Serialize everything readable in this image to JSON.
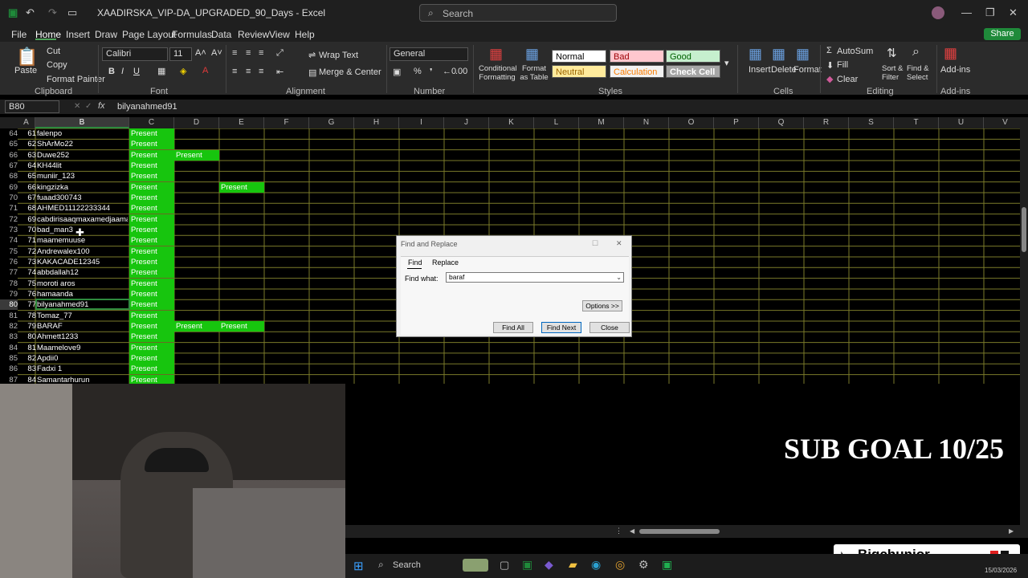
{
  "window": {
    "title": "XAADIRSKA_VIP-DA_UPGRADED_90_Days  -  Excel",
    "search_placeholder": "Search"
  },
  "menu": {
    "file": "File",
    "home": "Home",
    "insert": "Insert",
    "draw": "Draw",
    "page_layout": "Page Layout",
    "formulas": "Formulas",
    "data": "Data",
    "review": "Review",
    "view": "View",
    "help": "Help",
    "share": "Share"
  },
  "ribbon": {
    "clipboard": {
      "paste": "Paste",
      "cut": "Cut",
      "copy": "Copy",
      "format_painter": "Format Painter",
      "label": "Clipboard"
    },
    "font": {
      "name": "Calibri",
      "size": "11",
      "label": "Font"
    },
    "alignment": {
      "wrap_text": "Wrap Text",
      "merge_center": "Merge & Center",
      "label": "Alignment"
    },
    "number": {
      "format": "General",
      "label": "Number"
    },
    "styles": {
      "conditional": "Conditional Formatting",
      "format_table": "Format as Table",
      "normal": "Normal",
      "bad": "Bad",
      "good": "Good",
      "neutral": "Neutral",
      "calculation": "Calculation",
      "check_cell": "Check Cell",
      "label": "Styles"
    },
    "cells": {
      "insert": "Insert",
      "delete": "Delete",
      "format": "Format",
      "label": "Cells"
    },
    "editing": {
      "autosum": "AutoSum",
      "fill": "Fill",
      "clear": "Clear",
      "sort_filter": "Sort & Filter",
      "find_select": "Find & Select",
      "label": "Editing"
    },
    "addins": {
      "addins": "Add-ins",
      "label": "Add-ins"
    }
  },
  "formula_bar": {
    "name_box": "B80",
    "value": "bilyanahmed91"
  },
  "columns": [
    "A",
    "B",
    "C",
    "D",
    "E",
    "F",
    "G",
    "H",
    "I",
    "J",
    "K",
    "L",
    "M",
    "N",
    "O",
    "P",
    "Q",
    "R",
    "S",
    "T",
    "U",
    "V"
  ],
  "rows": [
    {
      "row": "64",
      "a": "61",
      "b": "falenpo",
      "c": "Present",
      "d": "",
      "e": ""
    },
    {
      "row": "65",
      "a": "62",
      "b": "ShArMo22",
      "c": "Present",
      "d": "",
      "e": ""
    },
    {
      "row": "66",
      "a": "63",
      "b": "Duwe252",
      "c": "Present",
      "d": "Present",
      "e": ""
    },
    {
      "row": "67",
      "a": "64",
      "b": "KH44lit",
      "c": "Present",
      "d": "",
      "e": ""
    },
    {
      "row": "68",
      "a": "65",
      "b": "muniir_123",
      "c": "Present",
      "d": "",
      "e": ""
    },
    {
      "row": "69",
      "a": "66",
      "b": "kingzizka",
      "c": "Present",
      "d": "",
      "e": "Present"
    },
    {
      "row": "70",
      "a": "67",
      "b": "fuaad300743",
      "c": "Present",
      "d": "",
      "e": ""
    },
    {
      "row": "71",
      "a": "68",
      "b": "AHMED11122233344",
      "c": "Present",
      "d": "",
      "e": ""
    },
    {
      "row": "72",
      "a": "69",
      "b": "cabdirisaaqmaxamedjaamac",
      "c": "Present",
      "d": "",
      "e": ""
    },
    {
      "row": "73",
      "a": "70",
      "b": "bad_man3",
      "c": "Present",
      "d": "",
      "e": ""
    },
    {
      "row": "74",
      "a": "71",
      "b": "maamemuuse",
      "c": "Present",
      "d": "",
      "e": ""
    },
    {
      "row": "75",
      "a": "72",
      "b": "Andrewalex100",
      "c": "Present",
      "d": "",
      "e": ""
    },
    {
      "row": "76",
      "a": "73",
      "b": "KAKACADE12345",
      "c": "Present",
      "d": "",
      "e": ""
    },
    {
      "row": "77",
      "a": "74",
      "b": "abbdallah12",
      "c": "Present",
      "d": "",
      "e": ""
    },
    {
      "row": "78",
      "a": "75",
      "b": "moroti aros",
      "c": "Present",
      "d": "",
      "e": ""
    },
    {
      "row": "79",
      "a": "76",
      "b": "hamaanda",
      "c": "Present",
      "d": "",
      "e": ""
    },
    {
      "row": "80",
      "a": "77",
      "b": "bilyanahmed91",
      "c": "Present",
      "d": "",
      "e": ""
    },
    {
      "row": "81",
      "a": "78",
      "b": "Tomaz_77",
      "c": "Present",
      "d": "",
      "e": ""
    },
    {
      "row": "82",
      "a": "79",
      "b": "BARAF",
      "c": "Present",
      "d": "Present",
      "e": "Present"
    },
    {
      "row": "83",
      "a": "80",
      "b": "Ahmett1233",
      "c": "Present",
      "d": "",
      "e": ""
    },
    {
      "row": "84",
      "a": "81",
      "b": "Maamelove9",
      "c": "Present",
      "d": "",
      "e": ""
    },
    {
      "row": "85",
      "a": "82",
      "b": "Apdii0",
      "c": "Present",
      "d": "",
      "e": ""
    },
    {
      "row": "86",
      "a": "83",
      "b": "Fadxi 1",
      "c": "Present",
      "d": "",
      "e": ""
    },
    {
      "row": "87",
      "a": "84",
      "b": "Samantarhurun",
      "c": "Present",
      "d": "",
      "e": ""
    }
  ],
  "dialog": {
    "title": "Find and Replace",
    "tab_find": "Find",
    "tab_replace": "Replace",
    "find_label": "Find what:",
    "find_value": "baraf",
    "options": "Options >>",
    "find_all": "Find All",
    "find_next": "Find Next",
    "close": "Close"
  },
  "overlay": {
    "sub_goal": "SUB GOAL 10/25",
    "tiktok_name": "Bigchunior"
  },
  "taskbar": {
    "search": "Search",
    "date": "15/03/2026"
  },
  "colors": {
    "present": "#17c50e",
    "grid_line": "#7a7a2a",
    "excel_green": "#1f8a3a"
  }
}
